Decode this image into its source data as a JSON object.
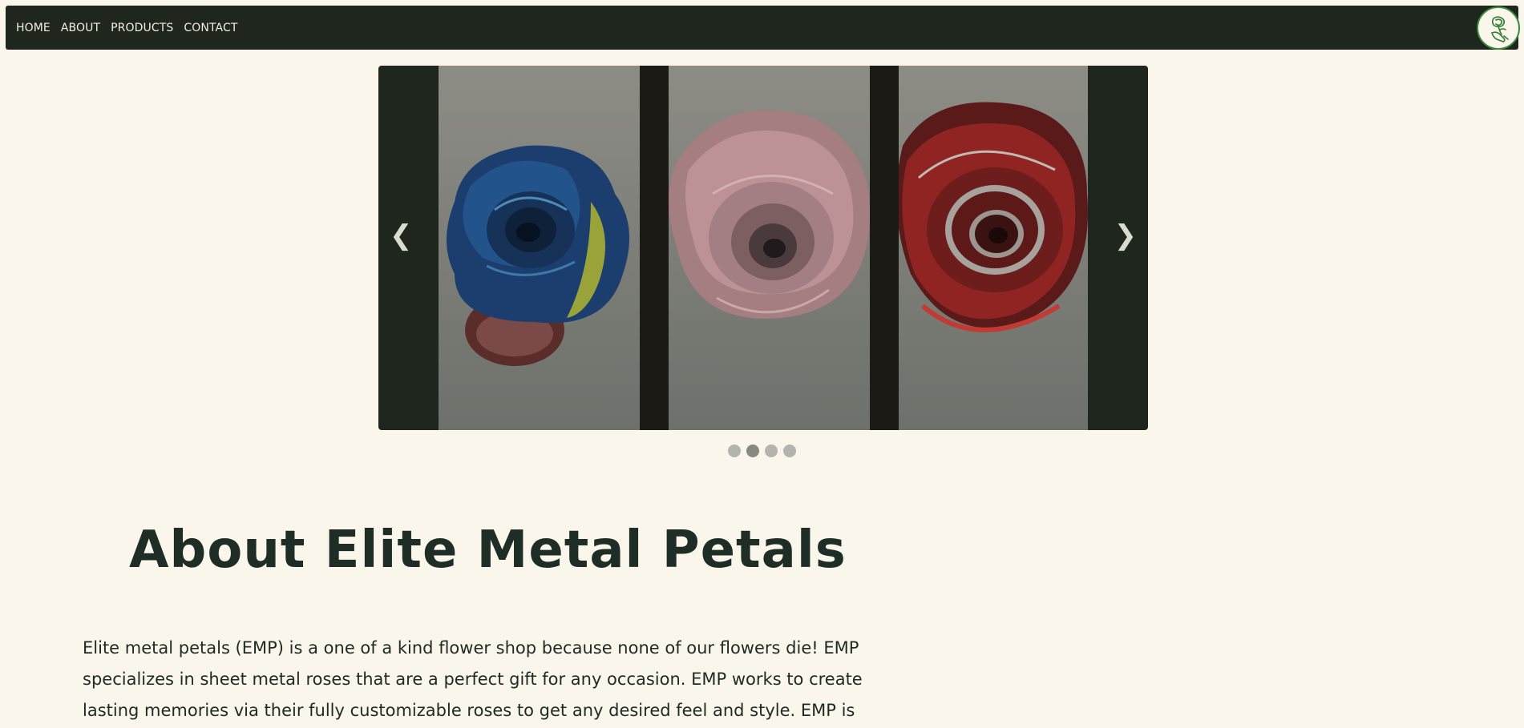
{
  "nav": {
    "links": [
      "HOME",
      "ABOUT",
      "PRODUCTS",
      "CONTACT"
    ],
    "logo_icon": "rose-hand-logo-icon"
  },
  "carousel": {
    "prev_arrow": "❮",
    "next_arrow": "❯",
    "slides": [
      {
        "name": "blue-yellow-metal-rose"
      },
      {
        "name": "pink-metal-rose"
      },
      {
        "name": "red-metal-rose"
      }
    ],
    "dots_total": 4,
    "active_dot": 2
  },
  "about": {
    "title": "About Elite Metal Petals",
    "paragraph_lines": [
      "Elite metal petals (EMP) is a one of a kind flower shop because none of our flowers die! EMP",
      "specializes in sheet metal roses that are a perfect gift for any occasion. EMP works to create",
      "lasting memories via their fully customizable roses to get any desired feel and style. EMP is"
    ]
  },
  "colors": {
    "background": "#fbf6ec",
    "navbar": "#1e261e",
    "accent_green": "#3b8a3e",
    "title": "#1e2d25"
  }
}
